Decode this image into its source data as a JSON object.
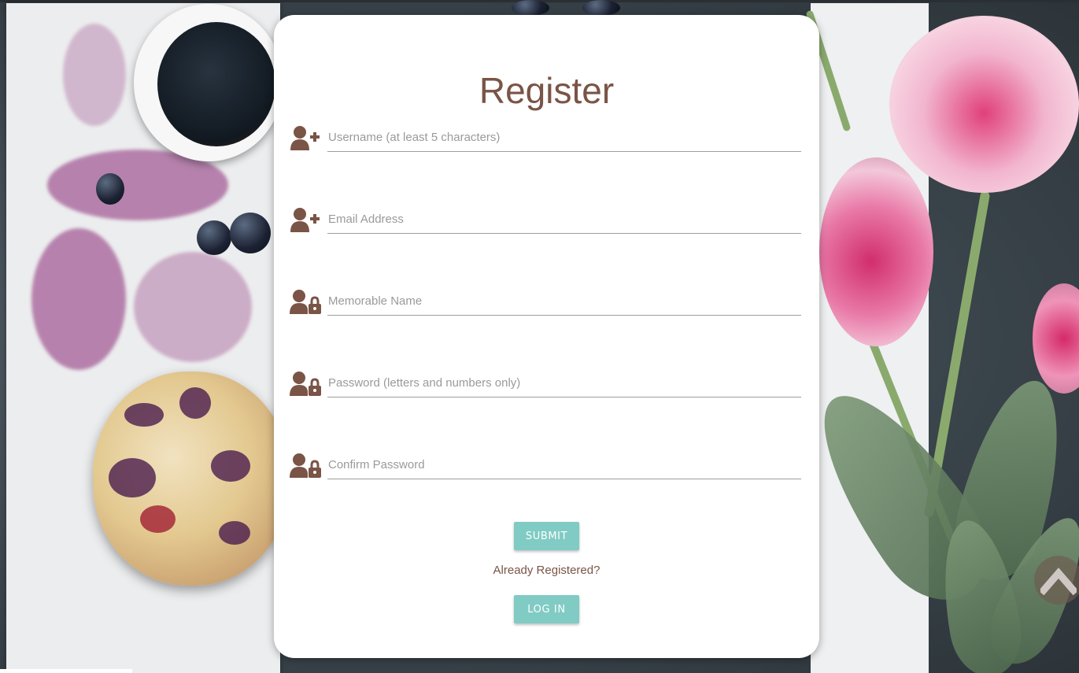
{
  "form": {
    "title": "Register",
    "fields": [
      {
        "placeholder": "Username (at least 5 characters)",
        "value": "",
        "icon": "user-plus-icon"
      },
      {
        "placeholder": "Email Address",
        "value": "",
        "icon": "user-plus-icon"
      },
      {
        "placeholder": "Memorable Name",
        "value": "",
        "icon": "user-lock-icon"
      },
      {
        "placeholder": "Password (letters and numbers only)",
        "value": "",
        "icon": "user-lock-icon"
      },
      {
        "placeholder": "Confirm Password",
        "value": "",
        "icon": "user-lock-icon"
      }
    ],
    "submit_label": "SUBMIT",
    "already_registered": "Already Registered?",
    "login_label": "LOG IN"
  },
  "colors": {
    "brand_brown": "#7a5446",
    "button_teal": "#80cbc4",
    "card_bg": "#ffffff"
  },
  "scroll_top_icon": "chevron-up-icon"
}
